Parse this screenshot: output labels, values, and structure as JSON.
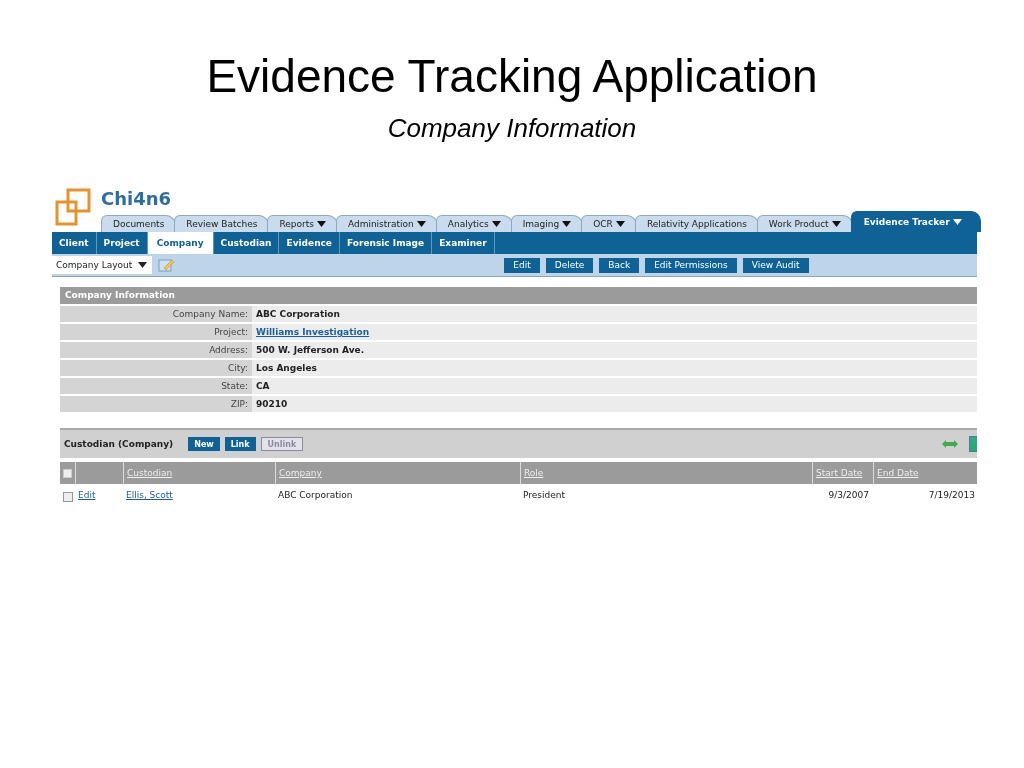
{
  "slide": {
    "title": "Evidence Tracking Application",
    "subtitle": "Company Information"
  },
  "app": {
    "brand": "Chi4n6",
    "tabs": [
      {
        "label": "Documents",
        "dropdown": false,
        "selected": false
      },
      {
        "label": "Review Batches",
        "dropdown": false,
        "selected": false
      },
      {
        "label": "Reports",
        "dropdown": true,
        "selected": false
      },
      {
        "label": "Administration",
        "dropdown": true,
        "selected": false
      },
      {
        "label": "Analytics",
        "dropdown": true,
        "selected": false
      },
      {
        "label": "Imaging",
        "dropdown": true,
        "selected": false
      },
      {
        "label": "OCR",
        "dropdown": true,
        "selected": false
      },
      {
        "label": "Relativity Applications",
        "dropdown": false,
        "selected": false
      },
      {
        "label": "Work Product",
        "dropdown": true,
        "selected": false
      },
      {
        "label": "Evidence Tracker",
        "dropdown": true,
        "selected": true
      }
    ],
    "nav": [
      {
        "label": "Client",
        "selected": false
      },
      {
        "label": "Project",
        "selected": false
      },
      {
        "label": "Company",
        "selected": true
      },
      {
        "label": "Custodian",
        "selected": false
      },
      {
        "label": "Evidence",
        "selected": false
      },
      {
        "label": "Forensic Image",
        "selected": false
      },
      {
        "label": "Examiner",
        "selected": false
      }
    ],
    "layout_select": {
      "value": "Company Layout"
    },
    "actions": [
      "Edit",
      "Delete",
      "Back",
      "Edit Permissions",
      "View Audit"
    ],
    "company_info": {
      "title": "Company Information",
      "fields": [
        {
          "label": "Company Name:",
          "value": "ABC Corporation",
          "kind": "text"
        },
        {
          "label": "Project:",
          "value": "Williams Investigation",
          "kind": "link"
        },
        {
          "label": "Address:",
          "value": "500 W. Jefferson Ave.",
          "kind": "text"
        },
        {
          "label": "City:",
          "value": "Los Angeles",
          "kind": "text"
        },
        {
          "label": "State:",
          "value": "CA",
          "kind": "text"
        },
        {
          "label": "ZIP:",
          "value": "90210",
          "kind": "text"
        }
      ]
    },
    "custodians": {
      "title": "Custodian (Company)",
      "buttons": [
        {
          "label": "New",
          "disabled": false
        },
        {
          "label": "Link",
          "disabled": false
        },
        {
          "label": "Unlink",
          "disabled": true
        }
      ],
      "select_all": {
        "checked": false
      },
      "columns": [
        "Custodian",
        "Company",
        "Role",
        "Start Date",
        "End Date"
      ],
      "rows": [
        {
          "checked": false,
          "edit": "Edit",
          "cells": [
            "Ellis, Scott",
            "ABC Corporation",
            "President",
            "9/3/2007",
            "7/19/2013"
          ]
        }
      ]
    }
  }
}
